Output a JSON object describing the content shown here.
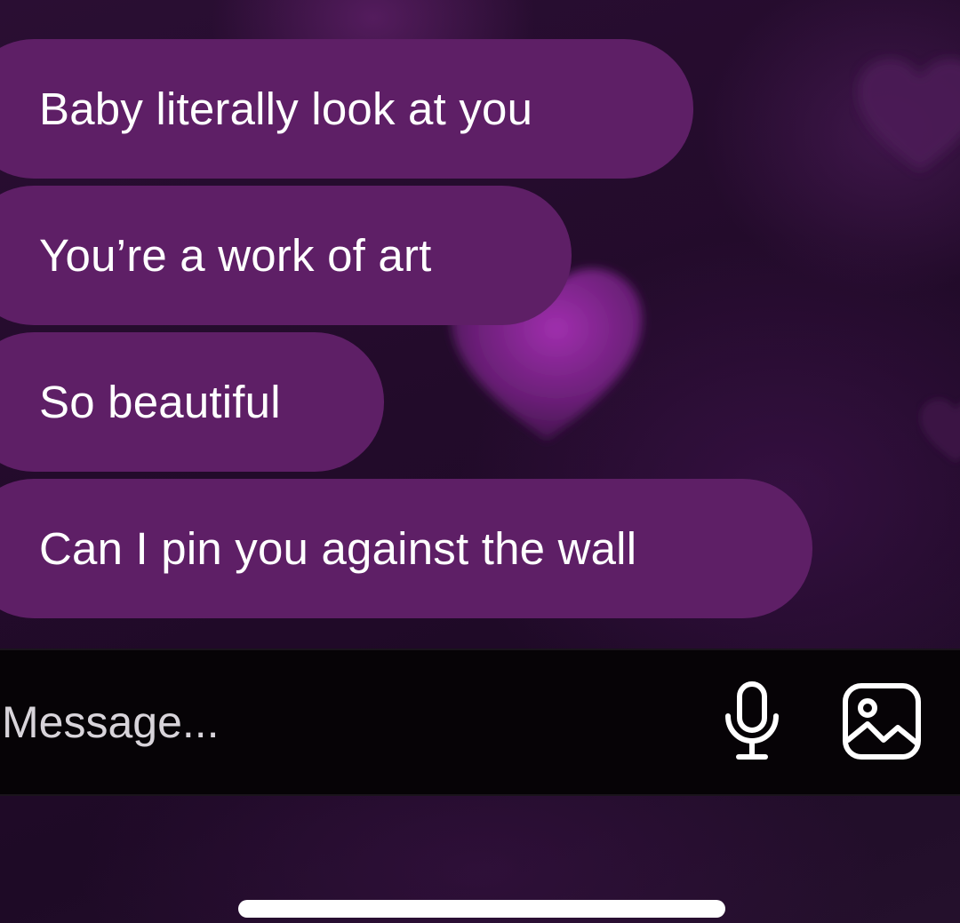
{
  "messages": [
    {
      "text": "Baby literally look at you"
    },
    {
      "text": "You’re a work of art"
    },
    {
      "text": "So beautiful"
    },
    {
      "text": "Can I pin you against the wall"
    }
  ],
  "composer": {
    "placeholder": "Message...",
    "mic_icon": "microphone-icon",
    "gallery_icon": "image-gallery-icon"
  },
  "colors": {
    "background": "#1d0a24",
    "bubble": "#5e1f66",
    "composer_bar": "#060306",
    "text": "#ffffff"
  }
}
